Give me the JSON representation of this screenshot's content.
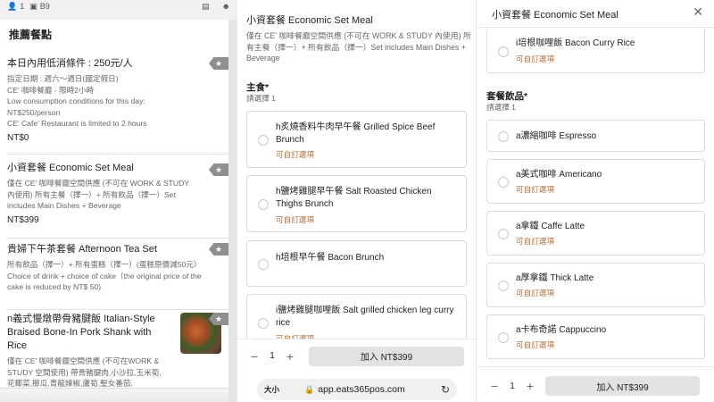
{
  "panel1": {
    "status": {
      "people": "1",
      "table": "B9"
    },
    "section_title": "推薦餐點",
    "items": [
      {
        "title": "本日內用低消條件 : 250元/人",
        "desc": "指定日期 : 週六～週日(國定假日)\nCE' 咖啡餐廳 - 限時2小時\nLow consumption conditions for this day: NT$250/person\nCE' Cafe' Restaurant is limited to 2 hours",
        "price": "NT$0"
      },
      {
        "title": "小資套餐 Economic Set Meal",
        "desc": "僅在 CE' 咖啡餐廳空間供應 (不可在 WORK & STUDY 內使用) 所有主餐（擇一）+ 所有飲品（擇一）Set includes Main Dishes + Beverage",
        "price": "NT$399"
      },
      {
        "title": "貴婦下午茶套餐 Afternoon Tea Set",
        "desc": "所有飲品（擇一）+ 所有蛋糕（擇一）(蛋糕原價減50元） Choice of drink + choice of cake（the original price of the cake is reduced by NT$ 50)",
        "price": ""
      },
      {
        "title": "n義式慢燉帶骨豬腱飯 Italian-Style Braised Bone-In Pork Shank with Rice",
        "desc": "僅在 CE' 咖啡餐廳空間供應 (不可在WORK & STUDY 空間使用) 帶骨豬腱肉,小沙拉,玉米筍,花椰菜,櫛瓜,青龍辣椒,蘆筍,聖女番茄,",
        "price": ""
      }
    ]
  },
  "panel2": {
    "title": "小資套餐 Economic Set Meal",
    "subtitle": "僅在 CE' 咖啡餐廳空間供應 (不可在 WORK & STUDY 內使用) 所有主餐（擇一）+ 所有飲品（擇一）Set includes Main Dishes + Beverage",
    "group_title": "主食*",
    "group_sub": "請選擇 1",
    "options": [
      {
        "name": "h炙燒香料牛肉早午餐 Grilled Spice Beef Brunch",
        "hint": "可自訂選項"
      },
      {
        "name": "h鹽烤雞腿早午餐 Salt Roasted Chicken Thighs Brunch",
        "hint": "可自訂選項"
      },
      {
        "name": "h培根早午餐 Bacon Brunch",
        "hint": ""
      },
      {
        "name": "i鹽烤雞腿咖哩飯 Salt grilled chicken leg curry rice",
        "hint": "可自訂選項"
      }
    ],
    "qty": "1",
    "add_label": "加入 NT$399",
    "browser": {
      "aa": "大小",
      "url": "app.eats365pos.com"
    }
  },
  "panel3": {
    "title": "小資套餐 Economic Set Meal",
    "top_option": {
      "name": "i培根咖哩飯 Bacon Curry Rice",
      "hint": "可自訂選項"
    },
    "group_title": "套餐飲品*",
    "group_sub": "請選擇 1",
    "options": [
      {
        "name": "a濃縮咖啡 Espresso",
        "hint": ""
      },
      {
        "name": "a美式咖啡 Americano",
        "hint": "可自訂選項"
      },
      {
        "name": "a拿鐵 Caffe Latte",
        "hint": "可自訂選項"
      },
      {
        "name": "a厚拿鐵 Thick Latte",
        "hint": "可自訂選項"
      },
      {
        "name": "a卡布奇諾 Cappuccino",
        "hint": "可自訂選項"
      }
    ],
    "qty": "1",
    "add_label": "加入 NT$399"
  }
}
